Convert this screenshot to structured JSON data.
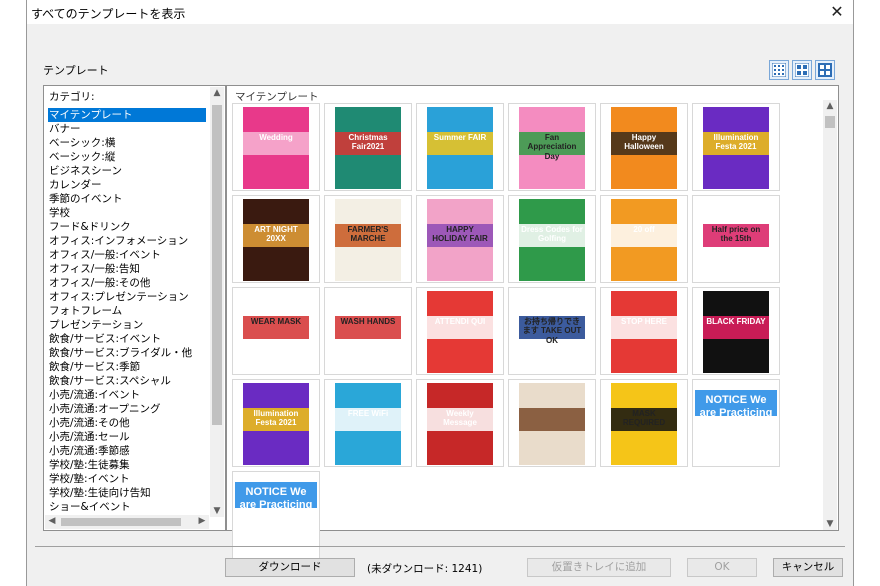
{
  "window": {
    "title": "すべてのテンプレートを表示",
    "close_glyph": "✕"
  },
  "section_label": "テンプレート",
  "category_list": {
    "header": "カテゴリ:",
    "selected_index": 0,
    "items": [
      "マイテンプレート",
      "バナー",
      "ベーシック:横",
      "ベーシック:縦",
      "ビジネスシーン",
      "カレンダー",
      "季節のイベント",
      "学校",
      "フード&ドリンク",
      "オフィス:インフォメーション",
      "オフィス/一般:イベント",
      "オフィス/一般:告知",
      "オフィス/一般:その他",
      "オフィス:プレゼンテーション",
      "フォトフレーム",
      "プレゼンテーション",
      "飲食/サービス:イベント",
      "飲食/サービス:ブライダル・他",
      "飲食/サービス:季節",
      "飲食/サービス:スペシャル",
      "小売/流通:イベント",
      "小売/流通:オープニング",
      "小売/流通:その他",
      "小売/流通:セール",
      "小売/流通:季節感",
      "学校/塾:生徒募集",
      "学校/塾:イベント",
      "学校/塾:生徒向け告知",
      "ショー&イベント"
    ]
  },
  "template_grid": {
    "title": "マイテンプレート",
    "templates": [
      {
        "name": "wedding-flyer",
        "bg": "#e8398a",
        "accent": "#f7b5d3",
        "text": "Wedding"
      },
      {
        "name": "christmas-fair",
        "bg": "#1f8a73",
        "accent": "#d33",
        "text": "Christmas Fair2021"
      },
      {
        "name": "summer-fair",
        "bg": "#2aa1d8",
        "accent": "#f5c518",
        "text": "Summer FAIR"
      },
      {
        "name": "fan-appreciation-day",
        "bg": "#f48cc0",
        "accent": "#2f9e44",
        "text": "Fan Appreciation Day"
      },
      {
        "name": "happy-halloween",
        "bg": "#f28a1e",
        "accent": "#3b2a1a",
        "text": "Happy Halloween"
      },
      {
        "name": "illumination-festa",
        "bg": "#6a2bc2",
        "accent": "#f1c40f",
        "text": "Illumination Festa 2021"
      },
      {
        "name": "art-night",
        "bg": "#3a1a10",
        "accent": "#e8a23a",
        "text": "ART NIGHT 20XX"
      },
      {
        "name": "farmers-marche",
        "bg": "#f3efe4",
        "accent": "#c7561e",
        "text": "FARMER'S MARCHE"
      },
      {
        "name": "holiday-fair",
        "bg": "#f2a3c8",
        "accent": "#8e4bb5",
        "text": "HAPPY HOLIDAY FAIR"
      },
      {
        "name": "dress-codes-golfing",
        "bg": "#2f9a4a",
        "accent": "#ffffff",
        "text": "Dress Codes for Golfing"
      },
      {
        "name": "sale-20-off",
        "bg": "#f29a22",
        "accent": "#ffffff",
        "text": "20 off"
      },
      {
        "name": "half-price-15th",
        "bg": "#ffffff",
        "accent": "#d81b60",
        "text": "Half price on the 15th"
      },
      {
        "name": "wear-mask",
        "bg": "#ffffff",
        "accent": "#d32f2f",
        "text": "WEAR MASK"
      },
      {
        "name": "wash-hands",
        "bg": "#ffffff",
        "accent": "#d32f2f",
        "text": "WASH HANDS"
      },
      {
        "name": "attendi-qui",
        "bg": "#e53935",
        "accent": "#ffffff",
        "text": "ATTENDI QUI"
      },
      {
        "name": "take-out-ok",
        "bg": "#ffffff",
        "accent": "#1a3e8c",
        "text": "お持ち帰りできます TAKE OUT OK"
      },
      {
        "name": "stop-here",
        "bg": "#e53935",
        "accent": "#ffffff",
        "text": "STOP HERE"
      },
      {
        "name": "black-friday",
        "bg": "#111111",
        "accent": "#e91e63",
        "text": "BLACK FRIDAY"
      },
      {
        "name": "illumination-festa-2",
        "bg": "#6a2bc2",
        "accent": "#f1c40f",
        "text": "Illumination Festa 2021"
      },
      {
        "name": "free-wifi",
        "bg": "#2aa7d8",
        "accent": "#ffffff",
        "text": "FREE WiFi"
      },
      {
        "name": "weekly-message",
        "bg": "#c62828",
        "accent": "#ffffff",
        "text": "Weekly Message"
      },
      {
        "name": "restaurant-menu",
        "bg": "#e9dccb",
        "accent": "#7a4a2a",
        "text": ""
      },
      {
        "name": "mask-required",
        "bg": "#f5c518",
        "accent": "#111111",
        "text": "MASK REQUIRED"
      },
      {
        "name": "notice-social-distancing",
        "bg": "#ffffff",
        "accent": "#1e88e5",
        "text": "NOTICE We are Practicing Social Distancing",
        "wide": true
      },
      {
        "name": "notice-social-distancing-2",
        "bg": "#ffffff",
        "accent": "#1e88e5",
        "text": "NOTICE We are Practicing",
        "wide": true
      }
    ]
  },
  "footer": {
    "download_label": "ダウンロード",
    "status_text": "(未ダウンロード: 1241)",
    "add_to_tray_label": "仮置きトレイに追加",
    "ok_label": "OK",
    "cancel_label": "キャンセル"
  }
}
